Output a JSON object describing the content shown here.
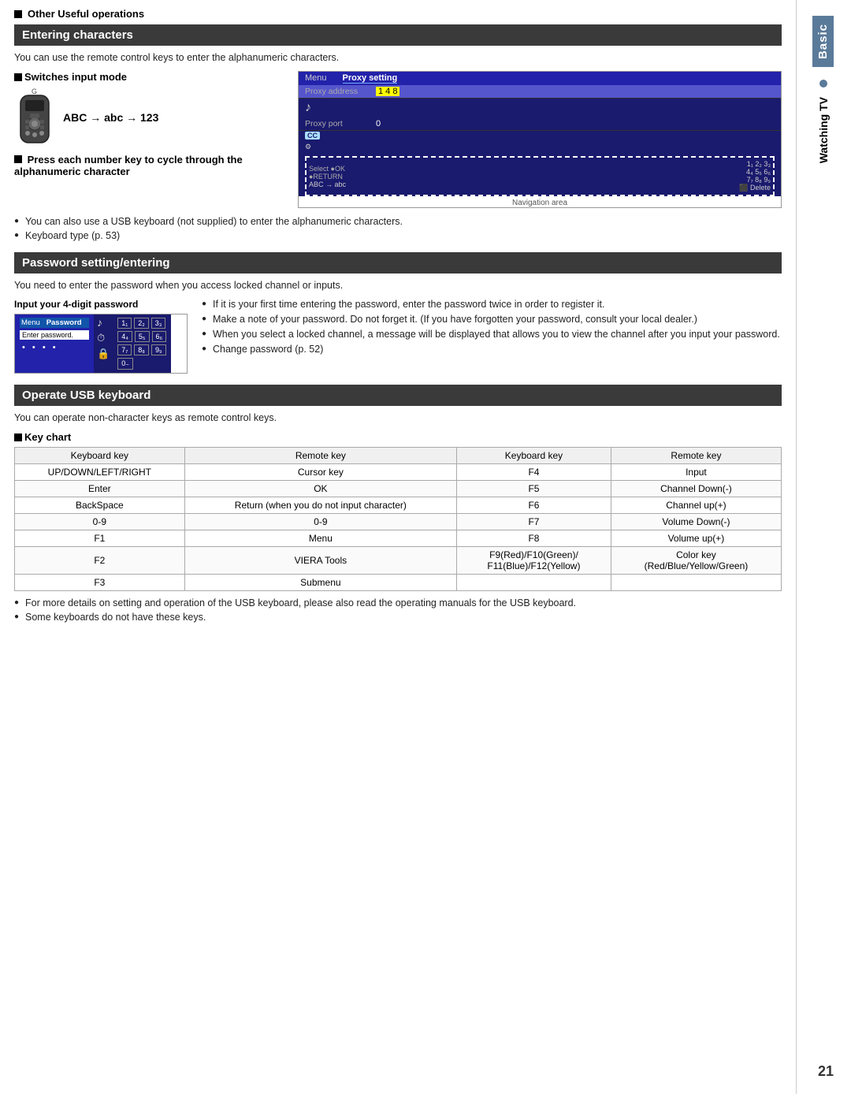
{
  "page": {
    "number": "21",
    "other_useful": "Other Useful operations"
  },
  "sidebar": {
    "basic_label": "Basic",
    "watching_label": "Watching TV"
  },
  "entering_characters": {
    "title": "Entering characters",
    "intro": "You can use the remote control keys to enter the alphanumeric characters.",
    "switches_mode_title": "Switches input mode",
    "g_label": "G",
    "abc_arrow": "ABC → abc → 123",
    "press_number_title": "Press each number key to cycle through the alphanumeric character",
    "screen": {
      "menu_label": "Menu",
      "proxy_setting": "Proxy setting",
      "proxy_address": "Proxy address",
      "address_val": "1 4 8",
      "proxy_port": "Proxy port",
      "port_val": "0",
      "cc_label": "CC",
      "abc_arrow_small": "ABC → abc",
      "navigation_area": "Navigation area"
    },
    "bullets": [
      "You can also use a USB keyboard (not supplied) to enter the alphanumeric characters.",
      "Keyboard type (p. 53)"
    ]
  },
  "password_setting": {
    "title": "Password setting/entering",
    "intro": "You need to enter the password when you access locked channel or inputs.",
    "digit_label": "Input your 4-digit password",
    "screen": {
      "menu": "Menu",
      "password": "Password",
      "enter_password": "Enter password.",
      "dots": "• • • •"
    },
    "numpad_rows": [
      [
        "1₁",
        "2₂",
        "3₃"
      ],
      [
        "4₄",
        "5₅",
        "6₆"
      ],
      [
        "7₇",
        "8₈",
        "9₉"
      ],
      [
        "0₋"
      ]
    ],
    "bullets": [
      "If it is your first time entering the password, enter the password twice in order to register it.",
      "Make a note of your password. Do not forget it. (If you have forgotten your password, consult your local dealer.)",
      "When you select a locked channel, a message will be displayed that allows you to view the channel after you input your password.",
      "Change password (p. 52)"
    ]
  },
  "usb_keyboard": {
    "title": "Operate USB keyboard",
    "intro": "You can operate non-character keys as remote control keys.",
    "key_chart_title": "Key chart",
    "table_headers": [
      "Keyboard key",
      "Remote key",
      "Keyboard key",
      "Remote key"
    ],
    "table_rows": [
      [
        "UP/DOWN/LEFT/RIGHT",
        "Cursor key",
        "F4",
        "Input"
      ],
      [
        "Enter",
        "OK",
        "F5",
        "Channel Down(-)"
      ],
      [
        "BackSpace",
        "Return (when you do not input character)",
        "F6",
        "Channel up(+)"
      ],
      [
        "0-9",
        "0-9",
        "F7",
        "Volume Down(-)"
      ],
      [
        "F1",
        "Menu",
        "F8",
        "Volume up(+)"
      ],
      [
        "F2",
        "VIERA Tools",
        "F9(Red)/F10(Green)/\nF11(Blue)/F12(Yellow)",
        "Color key\n(Red/Blue/Yellow/Green)"
      ],
      [
        "F3",
        "Submenu",
        "",
        ""
      ]
    ],
    "bullets": [
      "For more details on setting and operation of the USB keyboard, please also read the operating manuals for the USB keyboard.",
      "Some keyboards do not have these keys."
    ]
  }
}
